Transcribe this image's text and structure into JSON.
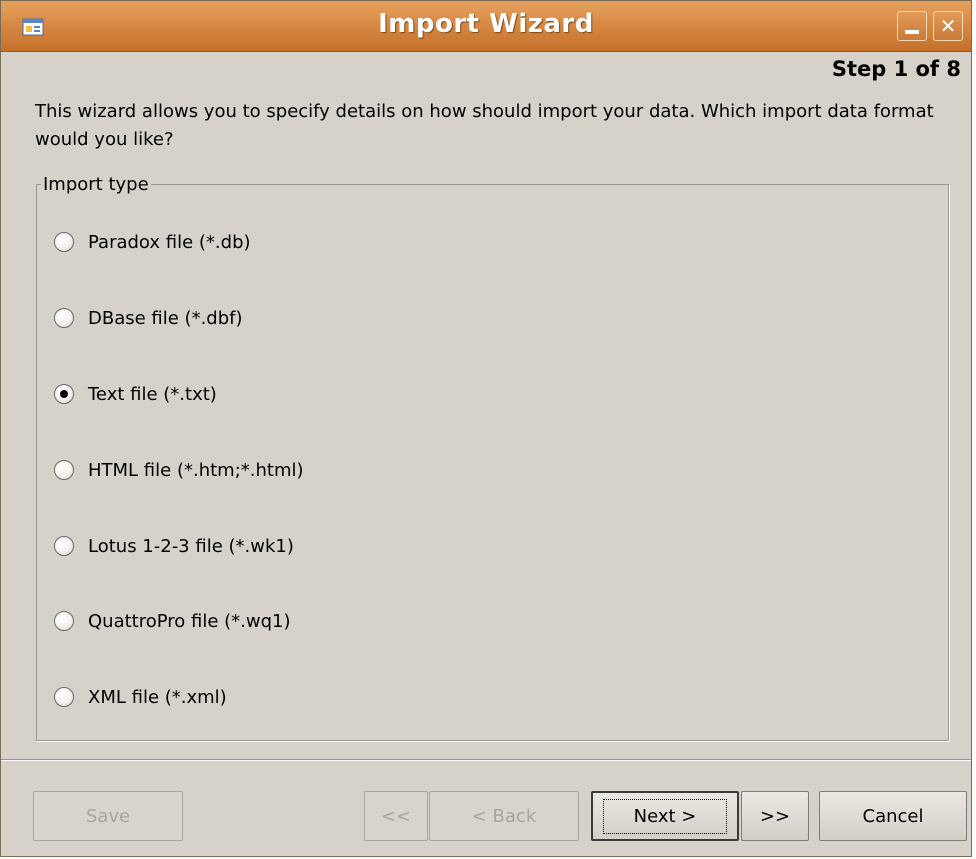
{
  "window": {
    "title": "Import Wizard",
    "minimize_glyph": "_",
    "close_glyph": "✕",
    "accent": "#d88a44"
  },
  "step": "Step 1 of 8",
  "description": "This wizard allows you to specify details on how should import your data. Which import data format would you like?",
  "import_type": {
    "legend": "Import type",
    "selected": "Text file (*.txt)",
    "options": [
      {
        "label": "Paradox file (*.db)",
        "checked": false
      },
      {
        "label": "DBase file (*.dbf)",
        "checked": false
      },
      {
        "label": "Text file (*.txt)",
        "checked": true
      },
      {
        "label": "HTML file (*.htm;*.html)",
        "checked": false
      },
      {
        "label": "Lotus 1-2-3 file (*.wk1)",
        "checked": false
      },
      {
        "label": "QuattroPro file (*.wq1)",
        "checked": false
      },
      {
        "label": "XML file (*.xml)",
        "checked": false
      }
    ]
  },
  "buttons": {
    "save": "Save",
    "first": "<<",
    "back": "< Back",
    "next": "Next >",
    "last": ">>",
    "cancel": "Cancel"
  }
}
